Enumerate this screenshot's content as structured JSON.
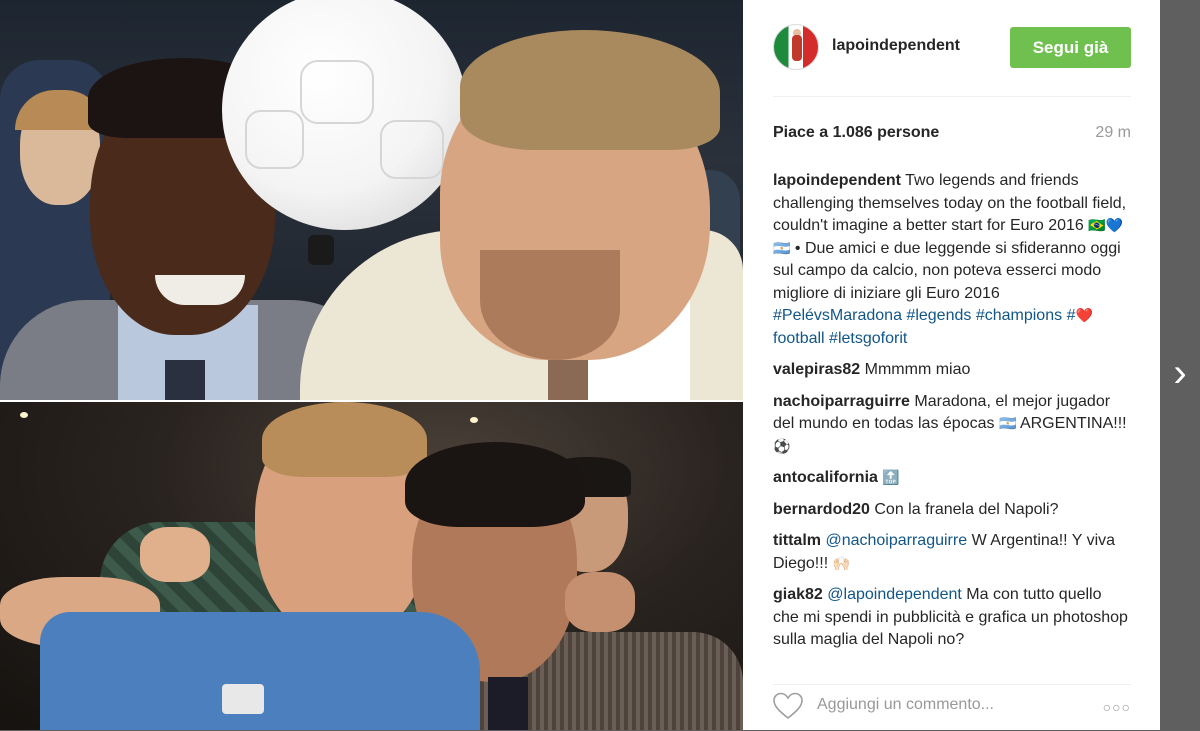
{
  "post": {
    "username": "lapoindependent",
    "follow_label": "Segui già",
    "likes": "Piace a 1.086 persone",
    "time": "29 m",
    "caption": {
      "user": "lapoindependent",
      "text": "Two legends and friends challenging themselves today on the football field, couldn't imagine a better start for Euro 2016",
      "flags": "🇧🇷💙🇦🇷",
      "text2": "• Due amici e due leggende si sfideranno oggi sul campo da calcio, non poteva esserci modo migliore di iniziare gli Euro 2016",
      "tag1": "#PelévsMaradona",
      "tag2": "#legends",
      "tag3": "#champions",
      "tag4_prefix": "#",
      "tag4_emoji": "❤️",
      "tag4_word": "football",
      "tag5": "#letsgoforit"
    },
    "comments": [
      {
        "user": "valepiras82",
        "text": "Mmmmm miao"
      },
      {
        "user": "nachoiparraguirre",
        "text": "Maradona, el mejor jugador del mundo en todas las épocas",
        "flag": "🇦🇷",
        "text2": "ARGENTINA!!!",
        "emoji": "⚽"
      },
      {
        "user": "antocalifornia",
        "emoji": "🔝"
      },
      {
        "user": "bernardod20",
        "text": "Con la franela del Napoli?"
      },
      {
        "user": "tittalm",
        "mention": "@nachoiparraguirre",
        "text": "W Argentina!! Y viva Diego!!!",
        "emoji": "🙌🏻"
      },
      {
        "user": "giak82",
        "mention": "@lapoindependent",
        "text": "Ma con tutto quello che mi spendi in pubblicità e grafica un photoshop sulla maglia del Napoli no?"
      }
    ],
    "add_comment_placeholder": "Aggiungi un commento...",
    "more_label": "○○○"
  },
  "nav": {
    "next_label": "›"
  },
  "colors": {
    "follow": "#70c050",
    "hashtag": "#125688",
    "text": "#262626",
    "muted": "#999999"
  }
}
